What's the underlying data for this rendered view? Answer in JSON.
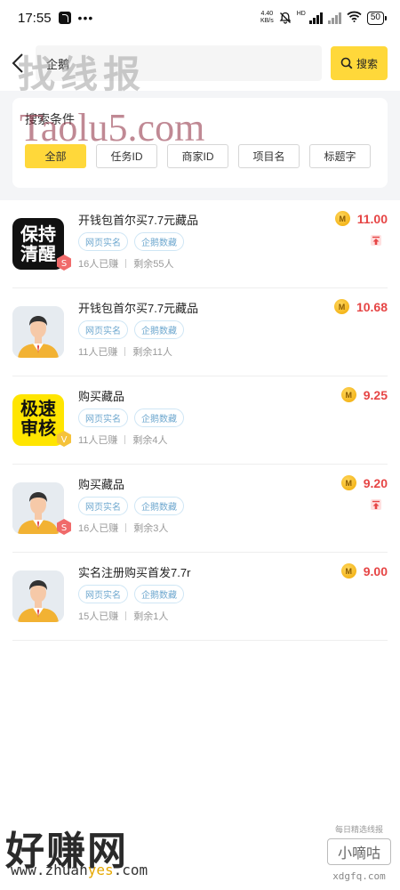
{
  "status_bar": {
    "time": "17:55",
    "dots": "•••",
    "net_speed_value": "4.40",
    "net_speed_unit": "KB/s",
    "hd": "HD",
    "battery": "50"
  },
  "search": {
    "query": "企鹅",
    "button_label": "搜索"
  },
  "filter": {
    "title": "搜索条件",
    "chips": [
      {
        "label": "全部",
        "active": true
      },
      {
        "label": "任务ID",
        "active": false
      },
      {
        "label": "商家ID",
        "active": false
      },
      {
        "label": "项目名",
        "active": false
      },
      {
        "label": "标题字",
        "active": false
      }
    ]
  },
  "tasks": [
    {
      "title": "开钱包首尔买7.7元藏品",
      "tags": [
        "网页实名",
        "企鹅数藏"
      ],
      "earned": "16人已赚",
      "remaining": "剩余55人",
      "price": "11.00",
      "thumb": "text-logo",
      "thumb_text": [
        "保持",
        "清醒"
      ],
      "badge": "s",
      "pinned": true
    },
    {
      "title": "开钱包首尔买7.7元藏品",
      "tags": [
        "网页实名",
        "企鹅数藏"
      ],
      "earned": "11人已赚",
      "remaining": "剩余11人",
      "price": "10.68",
      "thumb": "avatar",
      "badge": "",
      "pinned": false
    },
    {
      "title": "购买藏品",
      "tags": [
        "网页实名",
        "企鹅数藏"
      ],
      "earned": "11人已赚",
      "remaining": "剩余4人",
      "price": "9.25",
      "thumb": "text-logo-yellow",
      "thumb_text": [
        "极速",
        "审核"
      ],
      "badge": "v",
      "pinned": false
    },
    {
      "title": "购买藏品",
      "tags": [
        "网页实名",
        "企鹅数藏"
      ],
      "earned": "16人已赚",
      "remaining": "剩余3人",
      "price": "9.20",
      "thumb": "avatar",
      "badge": "s",
      "pinned": true
    },
    {
      "title": "实名注册购买首发7.7r",
      "tags": [
        "网页实名",
        "企鹅数藏"
      ],
      "earned": "15人已赚",
      "remaining": "剩余1人",
      "price": "9.00",
      "thumb": "avatar",
      "badge": "",
      "pinned": false
    }
  ],
  "watermarks": {
    "zhaoxianbao": "找线报",
    "taolu": "Taolu5.com",
    "haozhuan": "好赚网",
    "zhuanyes_pre": "www.zhuan",
    "zhuanyes_mid": "yes",
    "zhuanyes_post": ".com",
    "dgfq_top": "每日精选线报",
    "dgfq_box": "小嘀咕",
    "dgfq_url": "xdgfq.com"
  },
  "colors": {
    "accent": "#ffd83a",
    "price": "#e64545",
    "tag": "#6fa8cf"
  }
}
